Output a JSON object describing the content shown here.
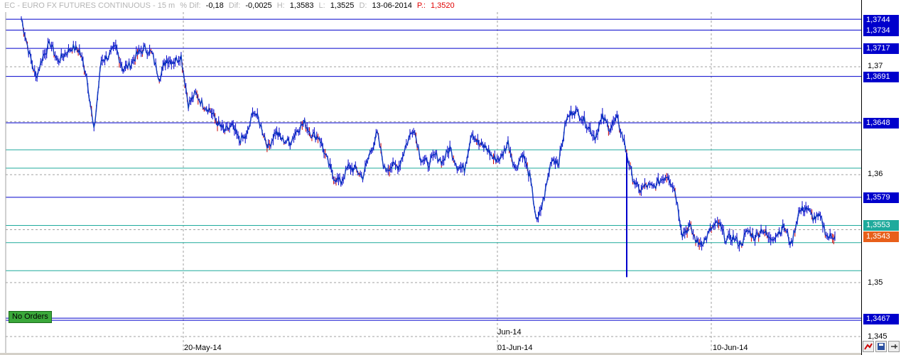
{
  "header": {
    "title": "EC - EURO FX FUTURES CONTINUOUS - 15 m",
    "pct_diff_label": "% Dif:",
    "pct_diff": "-0,18",
    "diff_label": "Dif:",
    "diff": "-0,0025",
    "high_label": "H:",
    "high": "1,3583",
    "low_label": "L:",
    "low": "1,3525",
    "date_label": "D:",
    "date": "13-06-2014",
    "price_label": "P.:",
    "price": "1,3520"
  },
  "axis": {
    "labels": [
      "1,37",
      "1,36",
      "1,35",
      "1,345"
    ],
    "tags": [
      {
        "text": "1,3744",
        "style": "blue"
      },
      {
        "text": "1,3734",
        "style": "blue"
      },
      {
        "text": "1,3717",
        "style": "blue"
      },
      {
        "text": "1,3691",
        "style": "blue"
      },
      {
        "text": "1,3648",
        "style": "blue"
      },
      {
        "text": "1,3579",
        "style": "blue"
      },
      {
        "text": "1,3553",
        "style": "teal"
      },
      {
        "text": "1,3543",
        "style": "orange"
      },
      {
        "text": "1,3467",
        "style": "blue"
      }
    ]
  },
  "dates": {
    "d1": "20-May-14",
    "month": "Jun-14",
    "d2": "01-Jun-14",
    "d3": "10-Jun-14"
  },
  "no_orders": "No Orders",
  "colors": {
    "price_line": "#0000cc",
    "teal_line": "#1faa9c",
    "candle_up": "#0000cc",
    "candle_down": "#cc0000",
    "tag_blue": "#0000cc",
    "tag_teal": "#1faa9c",
    "tag_orange": "#e85f1a",
    "no_orders_bg": "#3aa83a"
  },
  "chart_data": {
    "type": "line",
    "title": "EC - EURO FX FUTURES CONTINUOUS - 15 m",
    "xlabel": "",
    "ylabel": "",
    "ylim": [
      1.344,
      1.3755
    ],
    "yticks": [
      1.345,
      1.35,
      1.36,
      1.37
    ],
    "x_labels": [
      "20-May-14",
      "Jun-14",
      "01-Jun-14",
      "10-Jun-14"
    ],
    "horizontal_levels": [
      {
        "value": 1.3744,
        "color": "blue"
      },
      {
        "value": 1.3734,
        "color": "blue"
      },
      {
        "value": 1.3717,
        "color": "blue"
      },
      {
        "value": 1.3691,
        "color": "blue"
      },
      {
        "value": 1.3648,
        "color": "blue"
      },
      {
        "value": 1.3579,
        "color": "blue"
      },
      {
        "value": 1.3553,
        "color": "teal"
      },
      {
        "value": 1.3467,
        "color": "blue"
      }
    ],
    "last_price": 1.3543,
    "series": [
      {
        "values": [
          1.3745,
          1.3715,
          1.369,
          1.371,
          1.3722,
          1.3705,
          1.3712,
          1.3718,
          1.3715,
          1.3692,
          1.364,
          1.3706,
          1.371,
          1.3718,
          1.3698,
          1.3702,
          1.3712,
          1.3717,
          1.3712,
          1.369,
          1.3707,
          1.3705,
          1.371,
          1.3665,
          1.3675,
          1.3665,
          1.366,
          1.3648,
          1.364,
          1.3645,
          1.3632,
          1.3635,
          1.366,
          1.3645,
          1.3625,
          1.364,
          1.3632,
          1.363,
          1.3642,
          1.3648,
          1.3637,
          1.3635,
          1.3615,
          1.3598,
          1.3593,
          1.3607,
          1.3605,
          1.3598,
          1.362,
          1.3638,
          1.3605,
          1.3608,
          1.3608,
          1.3628,
          1.3644,
          1.3615,
          1.361,
          1.3618,
          1.3612,
          1.3625,
          1.3608,
          1.3605,
          1.364,
          1.3628,
          1.3625,
          1.3615,
          1.3615,
          1.363,
          1.3605,
          1.362,
          1.3598,
          1.3555,
          1.358,
          1.3615,
          1.3612,
          1.365,
          1.366,
          1.3655,
          1.3645,
          1.3635,
          1.3653,
          1.3643,
          1.3652,
          1.363,
          1.36,
          1.3585,
          1.359,
          1.3588,
          1.3595,
          1.36,
          1.3585,
          1.3545,
          1.3552,
          1.3537,
          1.3538,
          1.355,
          1.3555,
          1.354,
          1.3542,
          1.3535,
          1.3548,
          1.3542,
          1.355,
          1.354,
          1.3545,
          1.3552,
          1.3535,
          1.3565,
          1.357,
          1.356,
          1.356,
          1.3542,
          1.3543
        ]
      }
    ]
  }
}
